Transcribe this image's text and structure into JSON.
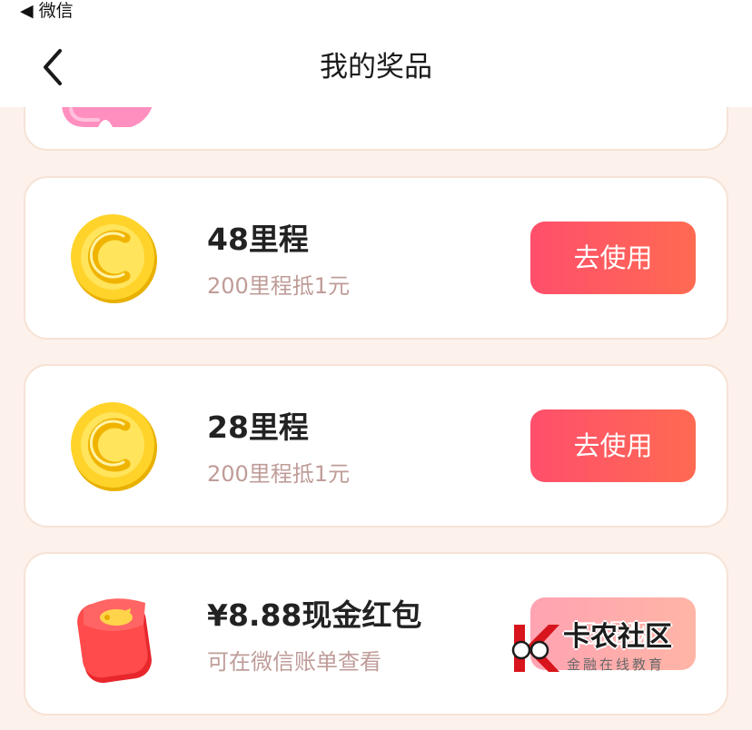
{
  "status_bar": {
    "back_app_label": "◀ 微信"
  },
  "nav": {
    "title": "我的奖品"
  },
  "prizes": [
    {
      "title": "48里程",
      "subtitle": "200里程抵1元",
      "button_label": "去使用",
      "icon": "gold-coin-icon"
    },
    {
      "title": "28里程",
      "subtitle": "200里程抵1元",
      "button_label": "去使用",
      "icon": "gold-coin-icon"
    },
    {
      "title": "¥8.88现金红包",
      "subtitle": "可在微信账单查看",
      "button_label": "已提现",
      "icon": "red-envelope-icon"
    }
  ],
  "watermark": {
    "brand": "卡农社区",
    "slogan": "金融在线教育"
  },
  "colors": {
    "page_background": "#fdf1ec",
    "button_gradient_start": "#ff4f6c",
    "button_gradient_end": "#ff6a52",
    "subtitle_text": "#bf9c98",
    "card_border": "#f6e2d5"
  }
}
